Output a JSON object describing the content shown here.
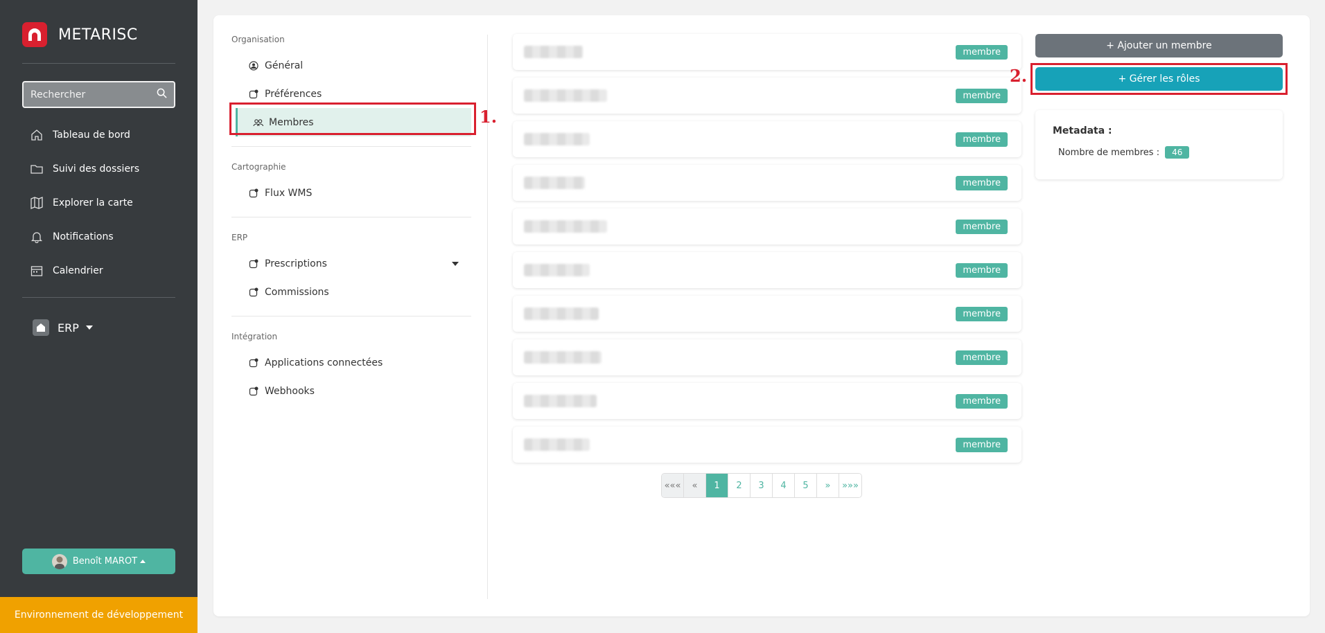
{
  "sidebar": {
    "brand": "METARISC",
    "search_placeholder": "Rechercher",
    "nav": [
      {
        "label": "Tableau de bord",
        "icon": "home-icon"
      },
      {
        "label": "Suivi des dossiers",
        "icon": "folder-icon"
      },
      {
        "label": "Explorer la carte",
        "icon": "map-icon"
      },
      {
        "label": "Notifications",
        "icon": "bell-icon"
      },
      {
        "label": "Calendrier",
        "icon": "calendar-icon"
      }
    ],
    "erp_label": "ERP",
    "user_name": "Benoît MAROT",
    "env_label": "Environnement de développement"
  },
  "settings": {
    "sections": [
      {
        "title": "Organisation",
        "items": [
          "Général",
          "Préférences",
          "Membres"
        ]
      },
      {
        "title": "Cartographie",
        "items": [
          "Flux WMS"
        ]
      },
      {
        "title": "ERP",
        "items": [
          "Prescriptions",
          "Commissions"
        ]
      },
      {
        "title": "Intégration",
        "items": [
          "Applications connectées",
          "Webhooks"
        ]
      }
    ],
    "active_item": "Membres"
  },
  "members": {
    "role_badge": "membre",
    "rows": 10
  },
  "pagination": {
    "first": "«««",
    "prev": "«",
    "pages": [
      "1",
      "2",
      "3",
      "4",
      "5"
    ],
    "next": "»",
    "last": "»»»",
    "current": "1"
  },
  "actions": {
    "add_member": "+   Ajouter un membre",
    "manage_roles": "+   Gérer les rôles"
  },
  "metadata": {
    "title": "Metadata :",
    "count_label": "Nombre de membres :",
    "count_value": "46"
  },
  "annotations": {
    "step1": "1.",
    "step2": "2."
  },
  "colors": {
    "accent": "#4fb5a2",
    "roles_button": "#17a2b8",
    "sidebar_bg": "#373b3e",
    "env_bar": "#f0a100",
    "annotation": "#d9202f"
  }
}
